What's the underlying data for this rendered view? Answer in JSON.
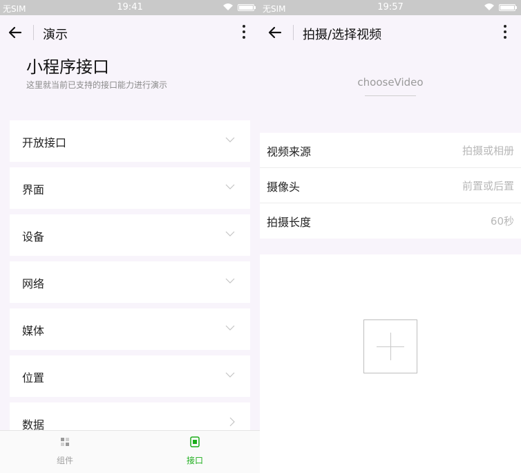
{
  "left": {
    "statusbar": {
      "carrier": "无SIM",
      "time": "19:41"
    },
    "nav": {
      "title": "演示"
    },
    "hero": {
      "title": "小程序接口",
      "desc": "这里就当前已支持的接口能力进行演示"
    },
    "menu": [
      {
        "label": "开放接口",
        "arrow": "down"
      },
      {
        "label": "界面",
        "arrow": "down"
      },
      {
        "label": "设备",
        "arrow": "down"
      },
      {
        "label": "网络",
        "arrow": "down"
      },
      {
        "label": "媒体",
        "arrow": "down"
      },
      {
        "label": "位置",
        "arrow": "down"
      },
      {
        "label": "数据",
        "arrow": "right"
      }
    ],
    "tabbar": {
      "components_label": "组件",
      "api_label": "接口",
      "active_color": "#1aad19",
      "inactive_color": "#a0a0a0"
    }
  },
  "right": {
    "statusbar": {
      "carrier": "无SIM",
      "time": "19:57"
    },
    "nav": {
      "title": "拍摄/选择视频"
    },
    "api_name": "chooseVideo",
    "form": [
      {
        "label": "视频来源",
        "value": "拍摄或相册"
      },
      {
        "label": "摄像头",
        "value": "前置或后置"
      },
      {
        "label": "拍摄长度",
        "value": "60秒"
      }
    ],
    "upload": {
      "icon": "plus-icon"
    }
  },
  "colors": {
    "page_bg": "#f8f4fb",
    "statusbar_bg": "#c9c9c9",
    "accent": "#1aad19"
  }
}
